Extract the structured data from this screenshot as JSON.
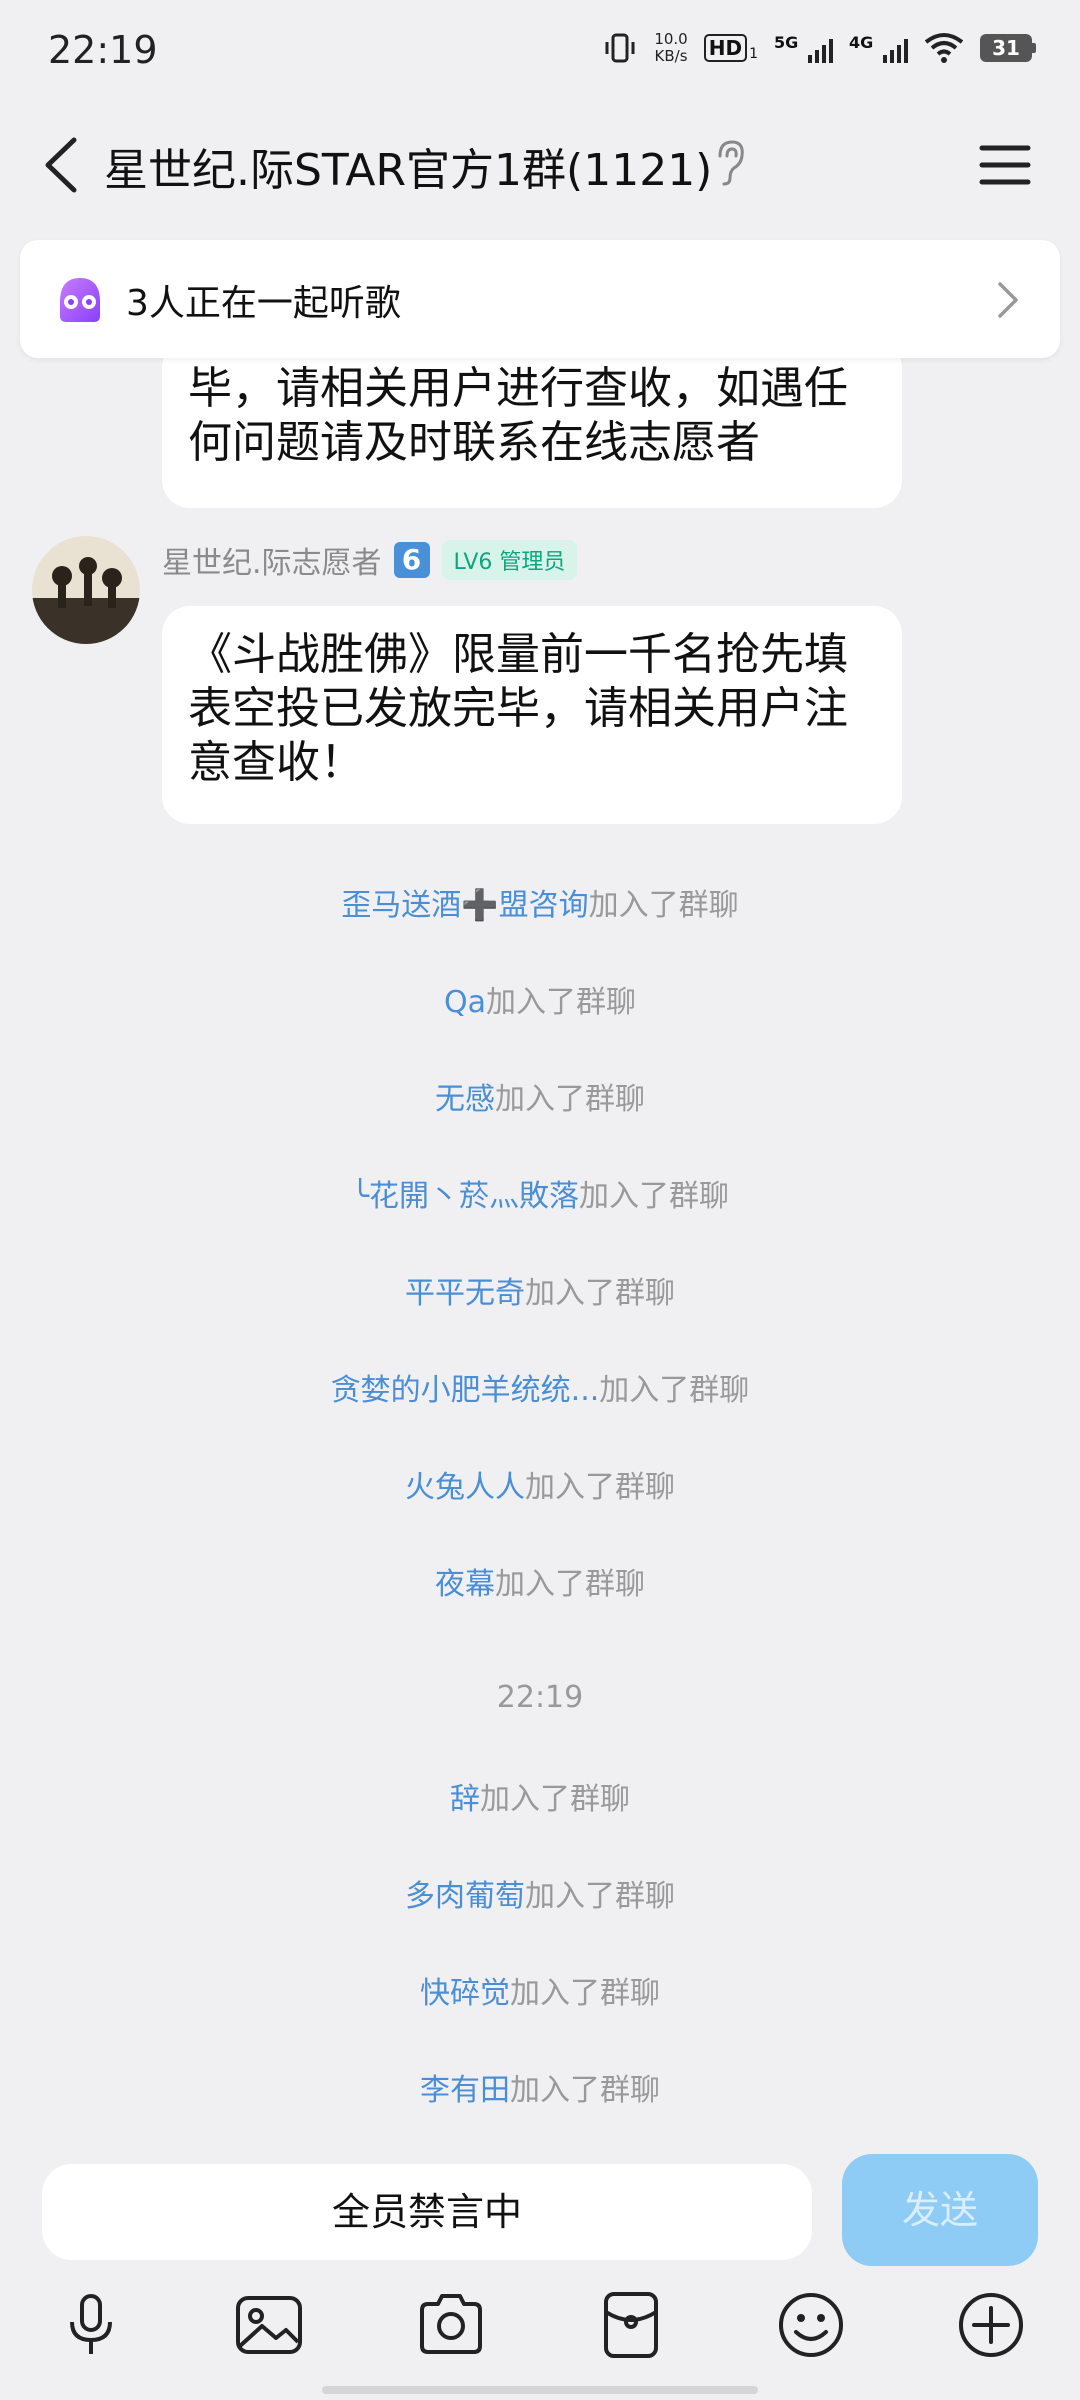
{
  "status_bar": {
    "time": "22:19",
    "net_speed_value": "10.0",
    "net_speed_unit": "KB/s",
    "hd_label": "HD",
    "hd_sub": "1",
    "sig1_label": "5G",
    "sig2_label": "4G",
    "battery": "31"
  },
  "header": {
    "title": "星世纪.际STAR官方1群(1121)"
  },
  "listen_banner": {
    "text": "3人正在一起听歌"
  },
  "messages": {
    "previous_bubble": {
      "line1": "毕，请相关用户进行查收，如遇任",
      "line2": "何问题请及时联系在线志愿者"
    },
    "main": {
      "sender_name": "星世纪.际志愿者",
      "sender_emoji": "6",
      "level_badge": "LV6 管理员",
      "line1": "《斗战胜佛》限量前一千名抢先填",
      "line2": "表空投已发放完毕，请相关用户注",
      "line3": "意查收！"
    }
  },
  "system_messages": [
    {
      "nick": "歪马送酒➕盟咨询",
      "suffix": "加入了群聊"
    },
    {
      "nick": "Qa",
      "suffix": "加入了群聊"
    },
    {
      "nick": "无感",
      "suffix": "加入了群聊"
    },
    {
      "nick": "╰花開丶菸灬敗落",
      "suffix": "加入了群聊"
    },
    {
      "nick": "平平无奇",
      "suffix": "加入了群聊"
    },
    {
      "nick": "贪婪的小肥羊统统...",
      "suffix": "加入了群聊"
    },
    {
      "nick": "火兔人人",
      "suffix": "加入了群聊"
    },
    {
      "nick": "夜幕",
      "suffix": "加入了群聊"
    }
  ],
  "timestamp": "22:19",
  "system_messages_after": [
    {
      "nick": "辞",
      "suffix": "加入了群聊"
    },
    {
      "nick": "多肉葡萄",
      "suffix": "加入了群聊"
    },
    {
      "nick": "快碎觉",
      "suffix": "加入了群聊"
    },
    {
      "nick": "李有田",
      "suffix": "加入了群聊"
    }
  ],
  "input": {
    "text": "全员禁言中",
    "send_label": "发送"
  },
  "toolbar": {
    "icons": [
      "microphone-icon",
      "image-icon",
      "camera-icon",
      "red-packet-icon",
      "emoji-icon",
      "plus-icon"
    ]
  },
  "colors": {
    "nick": "#4a8fd6",
    "send_button": "#8ecbf5",
    "level_badge": "#0ba67f"
  }
}
